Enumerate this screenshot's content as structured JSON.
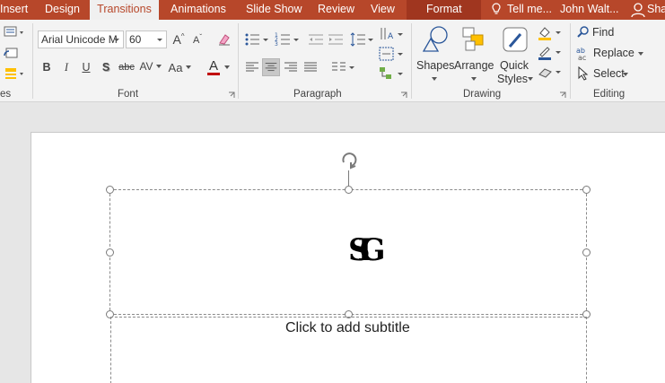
{
  "tabs": {
    "insert": "Insert",
    "design": "Design",
    "transitions": "Transitions",
    "animations": "Animations",
    "slideshow": "Slide Show",
    "review": "Review",
    "view": "View",
    "format": "Format",
    "tellme": "Tell me...",
    "user": "John Walt...",
    "share": "Sha"
  },
  "ribbon": {
    "slides_label_partial": "es",
    "font": {
      "label": "Font",
      "font_name": "Arial Unicode M",
      "font_size": "60",
      "bold": "B",
      "italic": "I",
      "underline": "U",
      "shadow": "S",
      "strikethrough": "abc",
      "spacing": "AV",
      "change_case": "Aa",
      "color_letter": "A",
      "grow": "A",
      "shrink": "A"
    },
    "paragraph": {
      "label": "Paragraph"
    },
    "drawing": {
      "label": "Drawing",
      "shapes": "Shapes",
      "arrange": "Arrange",
      "quick": "Quick",
      "styles": "Styles"
    },
    "editing": {
      "label": "Editing",
      "find": "Find",
      "replace": "Replace",
      "select": "Select"
    }
  },
  "slide": {
    "title_glyph": "SIG",
    "subtitle_placeholder": "Click to add subtitle"
  },
  "colors": {
    "accent": "#b7472a",
    "font_color": "#c00000",
    "highlight": "#ffc000"
  }
}
